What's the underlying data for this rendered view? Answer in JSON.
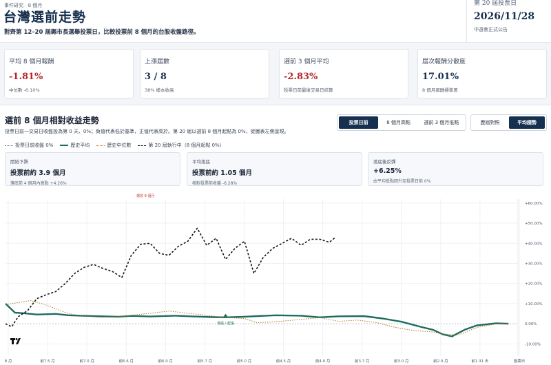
{
  "header": {
    "eyebrow": "事件研究 · 8 個月",
    "title": "台灣選前走勢",
    "subtitle": "對齊第 12–20 屆縣市長選舉投票日，比較投票前 8 個月的台股收盤路徑。",
    "right_label": "第 20 屆投票日",
    "right_date": "2026/11/28",
    "right_note": "中選會正式公告"
  },
  "stats": [
    {
      "title": "平均 8 個月報酬",
      "value": "-1.81%",
      "sub": "中位數 -6.10%",
      "tone": "neg"
    },
    {
      "title": "上漲屆數",
      "value": "3 / 8",
      "sub": "38% 樣本收高",
      "tone": "nav"
    },
    {
      "title": "選前 3 個月平均",
      "value": "-2.83%",
      "sub": "投票日前最後交易日結算",
      "tone": "neg"
    },
    {
      "title": "屆次報酬分散度",
      "value": "17.01%",
      "sub": "8 個月報酬標準差",
      "tone": "nav"
    }
  ],
  "panel": {
    "title": "選前 8 個月相對收益走勢",
    "desc": "投票日前一交易日收盤設為第 0 天、0%；負值代表低於基準，正值代表高於。第 20 屆以選前 8 個月起點為 0%，從圖表左側呈現。",
    "legend": [
      {
        "label": "投票日前收盤 0%",
        "style": "dotted",
        "color": "#6b7280"
      },
      {
        "label": "歷史平均",
        "style": "solid",
        "color": "#1f6b5f"
      },
      {
        "label": "歷史中位數",
        "style": "dotted",
        "color": "#b07a1f"
      },
      {
        "label": "第 20 屆執行中（8 個月起點 0%）",
        "style": "dashed",
        "color": "#111111"
      }
    ],
    "seg1": [
      {
        "label": "投票日前",
        "active": true
      },
      {
        "label": "8 個月高點",
        "active": false
      },
      {
        "label": "選前 3 個月低點",
        "active": false
      }
    ],
    "seg2": [
      {
        "label": "歷屆對照",
        "active": false
      },
      {
        "label": "平均趨勢",
        "active": true
      }
    ],
    "minis": [
      {
        "title": "開始下跌",
        "value": "投票前約 3.9 個月",
        "sub": "落底前 4 個月內高點 +4.26%"
      },
      {
        "title": "平均落底",
        "value": "投票前約 1.05 個月",
        "sub": "相對投票前收盤 -6.28%"
      },
      {
        "title": "落底後反彈",
        "value": "+6.25%",
        "sub": "由平均低點回升至投票日前 0%"
      }
    ],
    "top_note": "選前 8 個月"
  },
  "chart_data": {
    "type": "line",
    "x_unit": "months before vote",
    "xlim": [
      -8,
      0.15
    ],
    "ylim": [
      -14,
      62
    ],
    "y_ticks": [
      -10,
      0,
      10,
      20,
      30,
      40,
      50,
      60
    ],
    "y_tick_labels": [
      "-10.00%",
      "0.00%",
      "+10.00%",
      "+20.00%",
      "+30.00%",
      "+40.00%",
      "+50.00%",
      "+60.00%"
    ],
    "x_tick_labels": [
      "8 月",
      "前7.5 月",
      "前7.0 月",
      "前6.6 月",
      "前6.0 月",
      "前5.7 月",
      "前5.0 月",
      "前4.5 月",
      "前4.0 月",
      "前3.7 月",
      "前3.0 月",
      "前2.0 月",
      "前1.31 天",
      "投票日"
    ],
    "baseline_label": "落底 / 起漲",
    "series": [
      {
        "name": "歷史平均",
        "color": "#1f6b5f",
        "style": "solid",
        "x": [
          -8,
          -7.85,
          -7.7,
          -7.5,
          -7.2,
          -7.0,
          -6.6,
          -6.2,
          -6.0,
          -5.7,
          -5.3,
          -5.0,
          -4.7,
          -4.5,
          -4.2,
          -4.0,
          -3.7,
          -3.3,
          -3.0,
          -2.7,
          -2.3,
          -2.0,
          -1.7,
          -1.4,
          -1.2,
          -1.05,
          -0.9,
          -0.7,
          -0.5,
          -0.2,
          0
        ],
        "y": [
          10,
          5.5,
          5.2,
          4.6,
          4.9,
          4.2,
          3.8,
          3.5,
          3.9,
          3.6,
          4.0,
          3.6,
          3.3,
          3.2,
          3.5,
          3.8,
          4.2,
          4.0,
          3.2,
          3.7,
          3.8,
          2.6,
          1.0,
          -1.5,
          -3.0,
          -5.2,
          -6.3,
          -3.0,
          -0.8,
          0.2,
          0
        ]
      },
      {
        "name": "歷史中位數",
        "color": "#b07a1f",
        "style": "dotted",
        "x": [
          -8,
          -7.8,
          -7.6,
          -7.4,
          -7.2,
          -7.0,
          -6.8,
          -6.5,
          -6.2,
          -6.0,
          -5.7,
          -5.4,
          -5.1,
          -4.8,
          -4.5,
          -4.2,
          -4.0,
          -3.7,
          -3.4,
          -3.0,
          -2.7,
          -2.4,
          -2.1,
          -1.8,
          -1.5,
          -1.2,
          -1.05,
          -0.8,
          -0.5,
          -0.2,
          0
        ],
        "y": [
          9.5,
          10.5,
          11.5,
          9.8,
          7.5,
          5.0,
          4.0,
          3.2,
          3.5,
          4.2,
          5.2,
          6.3,
          5.2,
          4.2,
          3.1,
          2.6,
          0.5,
          1.0,
          1.9,
          3.0,
          1.2,
          1.8,
          0.6,
          -1.8,
          -3.4,
          -4.1,
          -5.0,
          -5.6,
          -1.8,
          -0.1,
          0
        ]
      },
      {
        "name": "第 20 屆執行中（8 個月起點 0%）",
        "color": "#111111",
        "style": "dashed",
        "x": [
          -8,
          -7.9,
          -7.8,
          -7.65,
          -7.5,
          -7.35,
          -7.2,
          -7.05,
          -6.9,
          -6.75,
          -6.6,
          -6.45,
          -6.3,
          -6.15,
          -6.0,
          -5.85,
          -5.7,
          -5.55,
          -5.4,
          -5.25,
          -5.1,
          -4.95,
          -4.8,
          -4.65,
          -4.5,
          -4.35,
          -4.2,
          -4.05,
          -3.9,
          -3.75,
          -3.6,
          -3.45,
          -3.3,
          -3.15,
          -3.0,
          -2.85,
          -2.75
        ],
        "y": [
          0,
          -1.5,
          3.5,
          6.5,
          12.5,
          14.5,
          16.0,
          20.0,
          25.0,
          28.0,
          29.5,
          27.5,
          26.0,
          23.0,
          34.0,
          39.5,
          40.0,
          35.0,
          34.0,
          38.5,
          41.0,
          47.5,
          39.0,
          42.5,
          32.0,
          37.5,
          41.0,
          25.0,
          33.0,
          37.5,
          40.0,
          42.5,
          39.0,
          42.0,
          42.0,
          40.5,
          43.0
        ]
      }
    ]
  }
}
